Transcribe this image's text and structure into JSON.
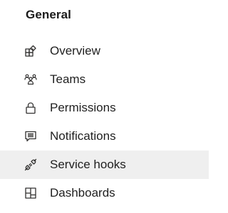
{
  "section": {
    "title": "General"
  },
  "nav": {
    "items": [
      {
        "label": "Overview",
        "icon": "overview-icon",
        "selected": false
      },
      {
        "label": "Teams",
        "icon": "teams-icon",
        "selected": false
      },
      {
        "label": "Permissions",
        "icon": "lock-icon",
        "selected": false
      },
      {
        "label": "Notifications",
        "icon": "notification-message-icon",
        "selected": false
      },
      {
        "label": "Service hooks",
        "icon": "plug-icon",
        "selected": true
      },
      {
        "label": "Dashboards",
        "icon": "dashboard-grid-icon",
        "selected": false
      }
    ]
  },
  "colors": {
    "selected_background": "#efefef",
    "text": "#1f1f1f",
    "icon": "#323130"
  }
}
